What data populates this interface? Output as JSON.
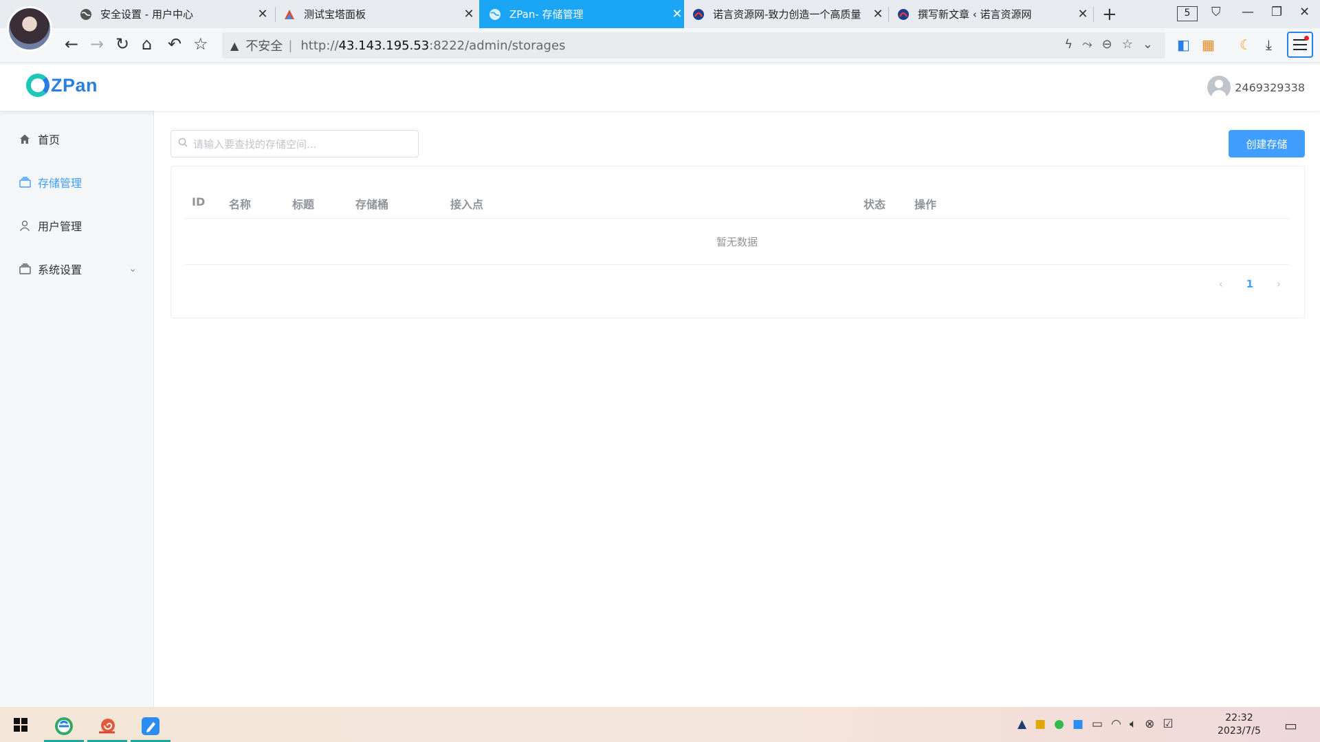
{
  "browser": {
    "tabs": [
      {
        "title": "安全设置 - 用户中心",
        "favicon": "globe-icon"
      },
      {
        "title": "测试宝塔面板",
        "favicon": "bt-panel-icon"
      },
      {
        "title": "ZPan- 存储管理",
        "favicon": "globe-icon",
        "active": true
      },
      {
        "title": "诺言资源网-致力创造一个高质量",
        "favicon": "site-logo-icon"
      },
      {
        "title": "撰写新文章 ‹ 诺言资源网",
        "favicon": "site-logo-icon"
      }
    ],
    "tab_count": "5",
    "address": {
      "insecure_label": "不安全",
      "url_prefix": "http://",
      "url_host": "43.143.195.53",
      "url_rest": ":8222/admin/storages"
    }
  },
  "app": {
    "logo_text": "ZPan",
    "username": "2469329338",
    "sidebar": [
      {
        "label": "首页",
        "icon": "home-icon"
      },
      {
        "label": "存储管理",
        "icon": "storage-icon",
        "active": true
      },
      {
        "label": "用户管理",
        "icon": "user-icon"
      },
      {
        "label": "系统设置",
        "icon": "settings-icon",
        "expandable": true
      }
    ],
    "search_placeholder": "请输入要查找的存储空间...",
    "create_button": "创建存储",
    "table": {
      "columns": [
        "ID",
        "名称",
        "标题",
        "存储桶",
        "接入点",
        "状态",
        "操作"
      ],
      "empty_text": "暂无数据"
    },
    "pagination": {
      "current_page": "1"
    }
  },
  "taskbar": {
    "time": "22:32",
    "date": "2023/7/5"
  }
}
